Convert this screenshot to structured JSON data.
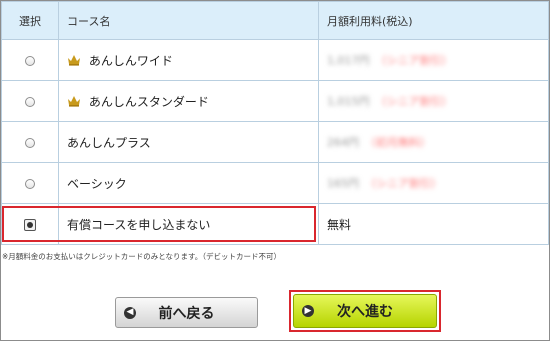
{
  "table": {
    "headers": {
      "select": "選択",
      "course": "コース名",
      "fee": "月額利用料(税込)"
    },
    "rows": [
      {
        "name": "あんしんワイド",
        "crown": true,
        "fee_price": "1,017円",
        "fee_note": "（シニア割引）",
        "fee_visible": false,
        "selected": false
      },
      {
        "name": "あんしんスタンダード",
        "crown": true,
        "fee_price": "1,015円",
        "fee_note": "（シニア割引）",
        "fee_visible": false,
        "selected": false
      },
      {
        "name": "あんしんプラス",
        "crown": false,
        "fee_price": "264円",
        "fee_note": "（初月無料）",
        "fee_visible": false,
        "selected": false
      },
      {
        "name": "ベーシック",
        "crown": false,
        "fee_price": "165円",
        "fee_note": "（シニア割引）",
        "fee_visible": false,
        "selected": false
      },
      {
        "name": "有償コースを申し込まない",
        "crown": false,
        "fee_text": "無料",
        "fee_visible": true,
        "selected": true
      }
    ]
  },
  "footnote": "※月額料金のお支払いはクレジットカードのみとなります。（デビットカード不可）",
  "buttons": {
    "back": {
      "label": "前へ戻る",
      "icon": "arrow-left-icon"
    },
    "next": {
      "label": "次へ進む",
      "icon": "arrow-right-icon"
    }
  },
  "colors": {
    "header_bg": "#dbeefa",
    "highlight": "#d9272e",
    "next_button": "#cde627",
    "crown": "#c89a1c"
  }
}
